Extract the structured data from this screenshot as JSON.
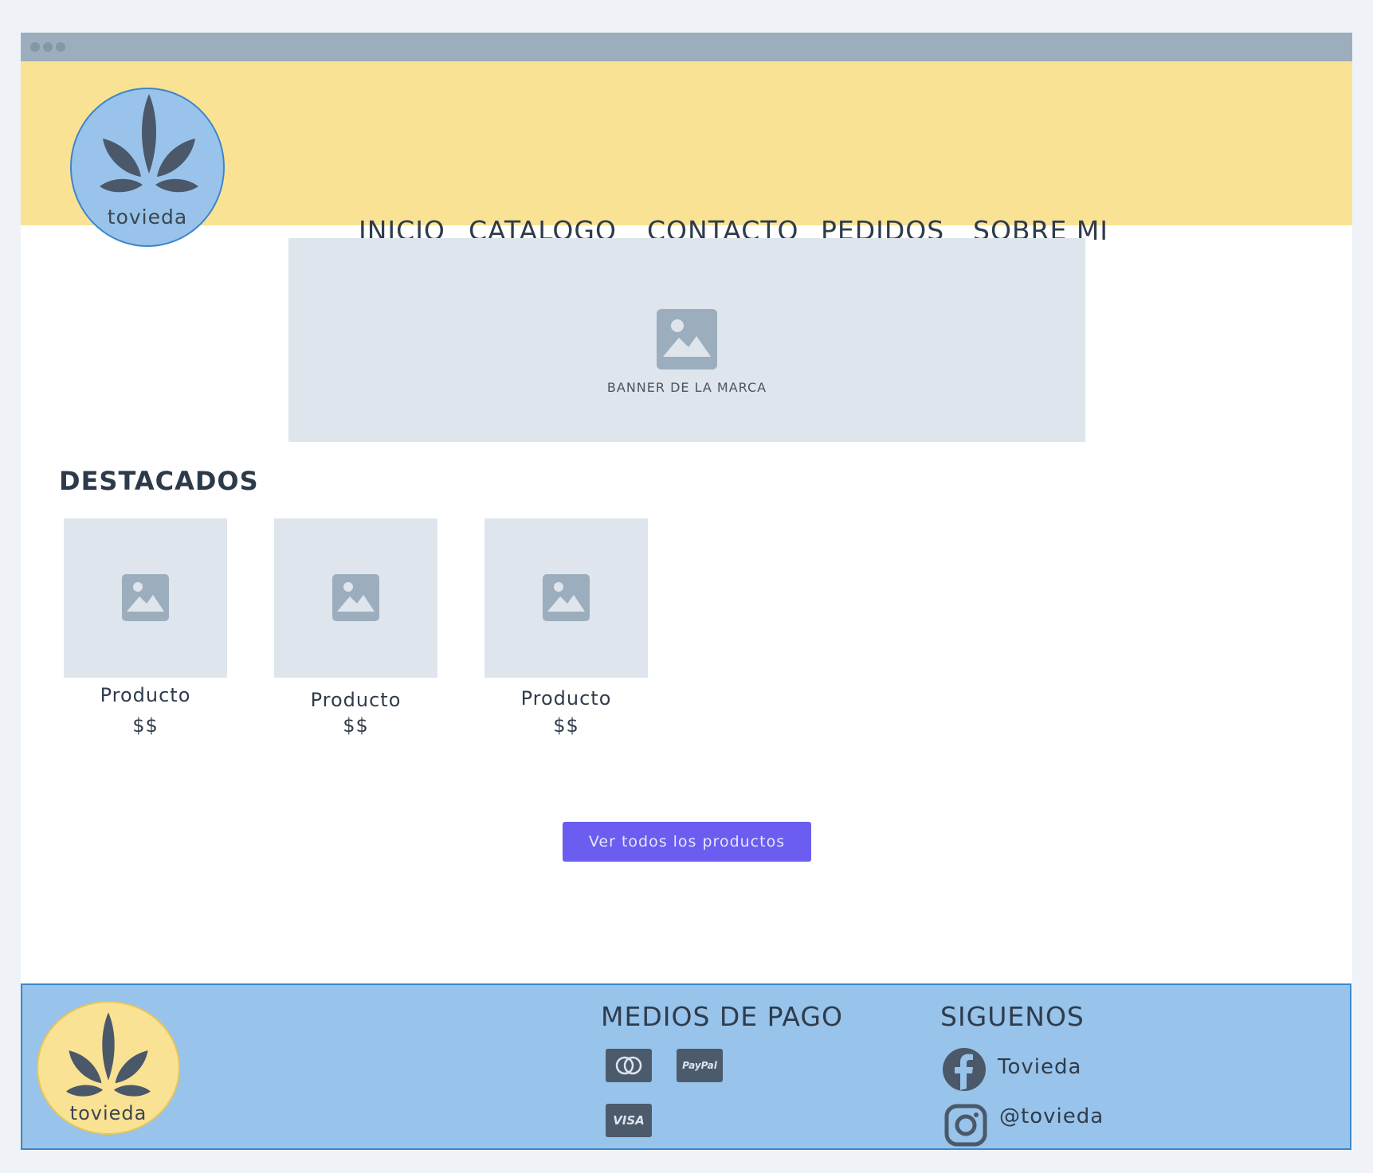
{
  "header": {
    "logo_text": "tovieda",
    "nav": [
      "INICIO",
      "CATALOGO",
      "CONTACTO",
      "PEDIDOS",
      "SOBRE MI"
    ]
  },
  "banner": {
    "label": "BANNER DE LA MARCA",
    "icon": "image-placeholder-icon"
  },
  "featured": {
    "title": "DESTACADOS",
    "products": [
      {
        "name": "Producto",
        "price": "$$"
      },
      {
        "name": "Producto",
        "price": "$$"
      },
      {
        "name": "Producto",
        "price": "$$"
      }
    ],
    "cta": "Ver todos los productos"
  },
  "footer": {
    "logo_text": "tovieda",
    "payments_title": "MEDIOS DE PAGO",
    "payments": [
      {
        "icon": "mastercard-icon",
        "label": ""
      },
      {
        "icon": "paypal-icon",
        "label": "PayPal"
      },
      {
        "icon": "visa-icon",
        "label": "VISA"
      }
    ],
    "social_title": "SIGUENOS",
    "social": [
      {
        "icon": "facebook-icon",
        "label": "Tovieda"
      },
      {
        "icon": "instagram-icon",
        "label": "@tovieda"
      }
    ]
  },
  "colors": {
    "header_bg": "#f9e293",
    "footer_bg": "#98c3ea",
    "button_bg": "#6a5df0",
    "placeholder_bg": "#dfe5ed",
    "text": "#2f3c4b"
  }
}
